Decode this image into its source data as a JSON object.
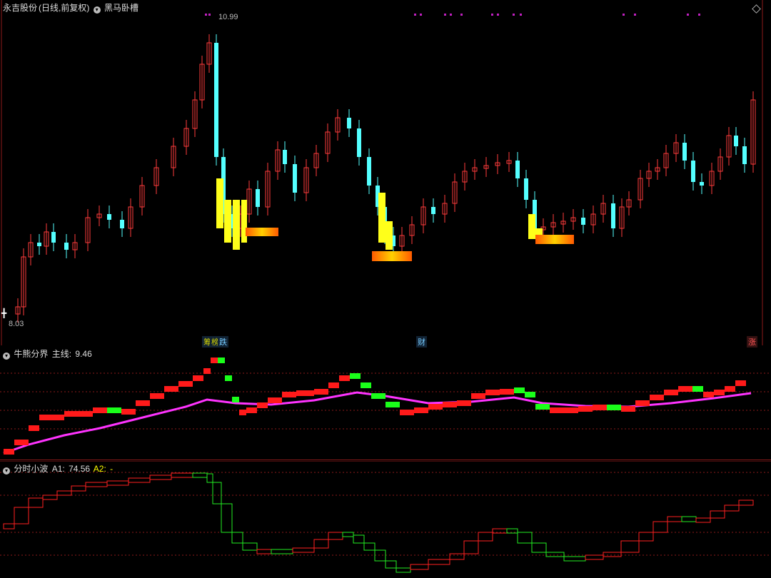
{
  "main": {
    "stock_name": "永吉股份",
    "mode": "(日线,前复权)",
    "indicator": "黑马卧槽",
    "high_label": "10.99",
    "low_label": "8.03",
    "tags": [
      {
        "text": "筹",
        "color": "#d4d400",
        "bg": "#123"
      },
      {
        "text": "榜",
        "color": "#d4d400",
        "bg": "#123"
      },
      {
        "text": "跌",
        "color": "#7cf",
        "bg": "#123"
      },
      {
        "text": "财",
        "color": "#7cf",
        "bg": "#123"
      },
      {
        "text": "涨",
        "color": "#f55",
        "bg": "#311"
      }
    ]
  },
  "sub1": {
    "name": "牛熊分界",
    "field": "主线:",
    "value": "9.46"
  },
  "sub2": {
    "name": "分时小波",
    "a1_label": "A1:",
    "a1_value": "74.56",
    "a2_label": "A2:",
    "a2_value": "-"
  },
  "colors": {
    "up": "#ff3b3b",
    "down": "#54ffff",
    "grid": "#8b1a1a",
    "bull": "#ff1a1a",
    "bear": "#1aff1a",
    "mainline": "#ff33ff"
  },
  "icons": [
    "dropdown-circle-icon",
    "diamond-icon",
    "crosshair-cursor-icon"
  ]
}
